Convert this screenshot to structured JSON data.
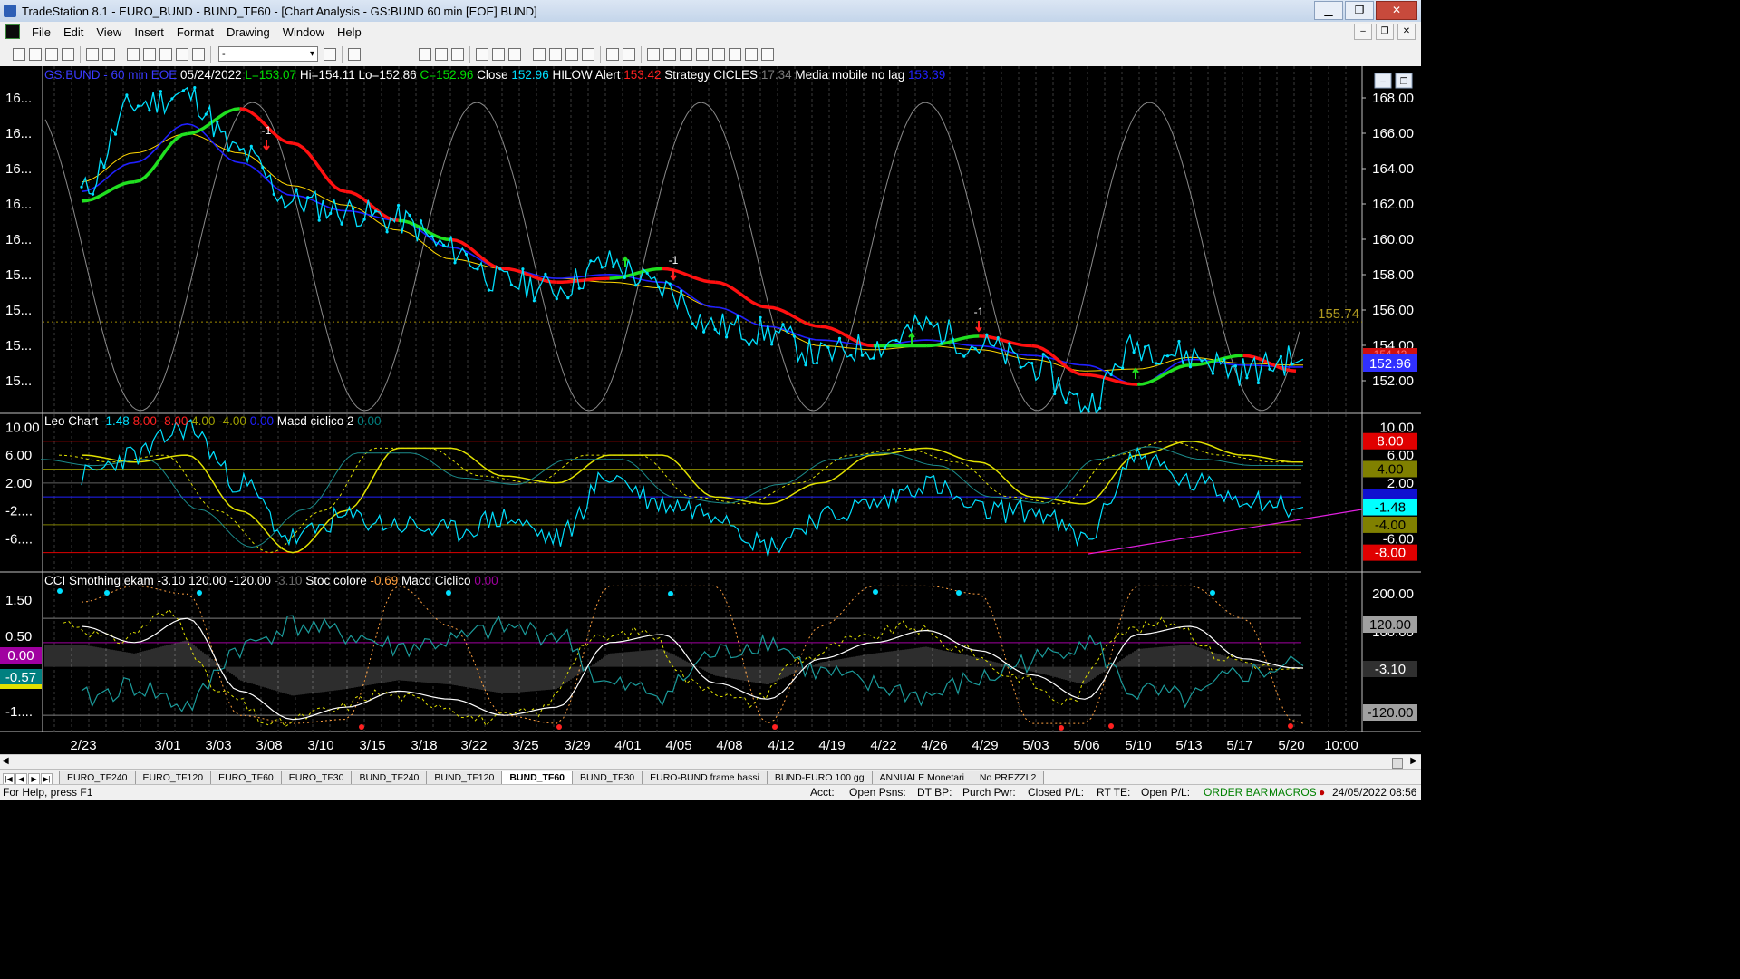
{
  "window": {
    "title": "TradeStation 8.1 - EURO_BUND - BUND_TF60 - [Chart Analysis - GS:BUND  60 min  [EOE] BUND]",
    "buttons": {
      "minimize": "▁",
      "maximize": "❐",
      "close": "✕"
    }
  },
  "menu": {
    "items": [
      "File",
      "Edit",
      "View",
      "Insert",
      "Format",
      "Drawing",
      "Window",
      "Help"
    ]
  },
  "toolbar": {
    "combo_value": "-"
  },
  "price_panel": {
    "header": [
      {
        "text": "GS:BUND - 60 min",
        "color": "#3a3aff"
      },
      {
        "text": "EOE",
        "color": "#3a3aff"
      },
      {
        "text": "05/24/2022",
        "color": "#ffffff"
      },
      {
        "text": "L=153.07",
        "color": "#00e000"
      },
      {
        "text": "Hi=154.11",
        "color": "#ffffff"
      },
      {
        "text": "Lo=152.86",
        "color": "#ffffff"
      },
      {
        "text": "C=152.96",
        "color": "#00e000"
      },
      {
        "text": "Close",
        "color": "#ffffff"
      },
      {
        "text": "152.96",
        "color": "#00e0ff"
      },
      {
        "text": "HILOW Alert",
        "color": "#ffffff"
      },
      {
        "text": "153.42",
        "color": "#ff2020"
      },
      {
        "text": "Strategy",
        "color": "#ffffff"
      },
      {
        "text": "CICLES",
        "color": "#ffffff"
      },
      {
        "text": "17.34",
        "color": "#7a7a7a"
      },
      {
        "text": "Media mobile no lag",
        "color": "#ffffff"
      },
      {
        "text": "153.39",
        "color": "#2020ff"
      }
    ],
    "left_ticks": [
      "16...",
      "16...",
      "16...",
      "16...",
      "16...",
      "15...",
      "15...",
      "15...",
      "15..."
    ],
    "right_ticks": [
      "168.00",
      "166.00",
      "164.00",
      "162.00",
      "160.00",
      "158.00",
      "156.00",
      "154.00",
      "152.00"
    ],
    "level_label": "155.74",
    "last_price_tag": "152.96",
    "hidden_tag": "154.42",
    "markers": [
      "-1",
      "-1",
      "-1"
    ]
  },
  "leo_panel": {
    "header": [
      {
        "text": "Leo Chart",
        "color": "#ffffff"
      },
      {
        "text": "-1.48",
        "color": "#00e0ff"
      },
      {
        "text": "8.00",
        "color": "#ff2020"
      },
      {
        "text": "-8.00",
        "color": "#ff2020"
      },
      {
        "text": "4.00",
        "color": "#a0a000"
      },
      {
        "text": "-4.00",
        "color": "#a0a000"
      },
      {
        "text": "0.00",
        "color": "#2020ff"
      },
      {
        "text": "Macd ciclico 2",
        "color": "#ffffff"
      },
      {
        "text": "0.00",
        "color": "#008080"
      }
    ],
    "left_ticks": [
      "10.00",
      "6.00",
      "2.00",
      "-2....",
      "-6...."
    ],
    "right_ticks": [
      "10.00",
      "6.00",
      "2.00",
      "-6.00"
    ],
    "tags": [
      {
        "text": "8.00",
        "bg": "#e00000",
        "fg": "#ffffff"
      },
      {
        "text": "4.00",
        "bg": "#808000",
        "fg": "#000000"
      },
      {
        "text": "0.00",
        "bg": "#1010d0",
        "fg": "#1010d0"
      },
      {
        "text": "-1.48",
        "bg": "#00ffff",
        "fg": "#000000"
      },
      {
        "text": "-4.00",
        "bg": "#808000",
        "fg": "#000000"
      },
      {
        "text": "-8.00",
        "bg": "#e00000",
        "fg": "#ffffff"
      }
    ]
  },
  "cci_panel": {
    "header": [
      {
        "text": "CCI Smothing ekam",
        "color": "#ffffff"
      },
      {
        "text": "-3.10",
        "color": "#ffffff"
      },
      {
        "text": "120.00",
        "color": "#ffffff"
      },
      {
        "text": "-120.00",
        "color": "#ffffff"
      },
      {
        "text": "-3.10",
        "color": "#6a6a6a"
      },
      {
        "text": "Stoc colore",
        "color": "#ffffff"
      },
      {
        "text": "-0.69",
        "color": "#ffa040"
      },
      {
        "text": "Macd Ciclico",
        "color": "#ffffff"
      },
      {
        "text": "0.00",
        "color": "#a000a0"
      }
    ],
    "left_ticks": [
      "1.50",
      "0.50",
      "-1...."
    ],
    "left_tags": [
      {
        "text": "0.00",
        "bg": "#a000a0",
        "fg": "#ffffff"
      },
      {
        "text": "-0.57",
        "bg": "#008080",
        "fg": "#ffffff"
      }
    ],
    "right_ticks": [
      "200.00",
      "100.00"
    ],
    "tags": [
      {
        "text": "120.00",
        "bg": "#a0a0a0",
        "fg": "#000000"
      },
      {
        "text": "-3.10",
        "bg": "#303030",
        "fg": "#ffffff"
      },
      {
        "text": "-120.00",
        "bg": "#a0a0a0",
        "fg": "#000000"
      }
    ]
  },
  "x_axis": [
    "2/23",
    "3/01",
    "3/03",
    "3/08",
    "3/10",
    "3/15",
    "3/18",
    "3/22",
    "3/25",
    "3/29",
    "4/01",
    "4/05",
    "4/08",
    "4/12",
    "4/19",
    "4/22",
    "4/26",
    "4/29",
    "5/03",
    "5/06",
    "5/10",
    "5/13",
    "5/17",
    "5/20",
    "10:00"
  ],
  "tabs": [
    "EURO_TF240",
    "EURO_TF120",
    "EURO_TF60",
    "EURO_TF30",
    "BUND_TF240",
    "BUND_TF120",
    "BUND_TF60",
    "BUND_TF30",
    "EURO-BUND frame bassi",
    "BUND-EURO 100 gg",
    "ANNUALE Monetari",
    "No PREZZI 2"
  ],
  "active_tab": "BUND_TF60",
  "status": {
    "help": "For Help, press F1",
    "acct": "Acct:",
    "open_psns": "Open Psns:",
    "dt_bp": "DT BP:",
    "purch_pwr": "Purch Pwr:",
    "closed_pl": "Closed P/L:",
    "rt_te": "RT TE:",
    "open_pl": "Open P/L:",
    "order_bar": "ORDER BAR",
    "macros": "MACROS",
    "datetime": "24/05/2022 08:56"
  },
  "chart_data": [
    {
      "type": "line",
      "title": "GS:BUND - 60 min",
      "x": [
        "2/23",
        "3/01",
        "3/03",
        "3/08",
        "3/10",
        "3/15",
        "3/18",
        "3/22",
        "3/25",
        "3/29",
        "4/01",
        "4/05",
        "4/08",
        "4/12",
        "4/19",
        "4/22",
        "4/26",
        "4/29",
        "5/03",
        "5/06",
        "5/10",
        "5/13",
        "5/17",
        "5/20"
      ],
      "ylim": [
        151,
        169
      ],
      "series": [
        {
          "name": "Close",
          "color": "#00e0ff",
          "values": [
            162.5,
            167.0,
            167.5,
            164.5,
            162.0,
            161.5,
            161.0,
            159.5,
            157.8,
            157.5,
            158.8,
            157.5,
            155.5,
            155.2,
            154.0,
            154.5,
            155.5,
            154.5,
            153.5,
            151.5,
            154.5,
            154.0,
            153.2,
            153.8
          ]
        },
        {
          "name": "Media mobile no lag",
          "color": "#2020ff",
          "values": [
            162.5,
            164.0,
            166.0,
            164.0,
            162.3,
            161.5,
            161.0,
            159.6,
            158.5,
            158.0,
            158.2,
            157.8,
            156.5,
            155.5,
            154.8,
            154.5,
            154.8,
            154.5,
            154.0,
            153.5,
            152.5,
            153.8,
            153.5,
            153.4
          ]
        },
        {
          "name": "Strategy",
          "color": "#ffd700",
          "values": [
            163.0,
            164.5,
            165.5,
            164.5,
            162.8,
            161.8,
            160.5,
            159.0,
            158.5,
            158.0,
            157.8,
            157.5,
            156.5,
            155.5,
            154.5,
            154.3,
            154.5,
            154.3,
            153.8,
            153.2,
            153.3,
            153.9,
            153.6,
            153.5
          ]
        },
        {
          "name": "HILOW Alert",
          "color": "#ff2020",
          "values": [
            162.0,
            163.0,
            165.5,
            166.8,
            165.0,
            162.5,
            161.0,
            160.0,
            158.5,
            157.8,
            158.0,
            158.5,
            157.8,
            156.5,
            155.5,
            154.5,
            154.5,
            155.0,
            154.5,
            153.0,
            152.5,
            153.5,
            154.0,
            153.2
          ]
        }
      ]
    },
    {
      "type": "line",
      "title": "Leo Chart",
      "x": [
        "2/23",
        "3/01",
        "3/03",
        "3/08",
        "3/10",
        "3/15",
        "3/18",
        "3/22",
        "3/25",
        "3/29",
        "4/01",
        "4/05",
        "4/08",
        "4/12",
        "4/19",
        "4/22",
        "4/26",
        "4/29",
        "5/03",
        "5/06",
        "5/10",
        "5/13",
        "5/17",
        "5/20"
      ],
      "ylim": [
        -10,
        12
      ],
      "series": [
        {
          "name": "Leo Chart",
          "color": "#00e0ff",
          "values": [
            3.0,
            6.0,
            10.0,
            2.0,
            -6.0,
            -3.0,
            -4.0,
            -5.0,
            -3.0,
            -6.0,
            3.0,
            -1.0,
            -2.0,
            -7.0,
            -3.0,
            -1.0,
            2.0,
            -2.0,
            -2.0,
            -6.0,
            6.0,
            2.0,
            0.0,
            -1.48
          ]
        },
        {
          "name": "Macd ciclico 2",
          "color": "#e0e000",
          "values": [
            6.0,
            5.0,
            6.0,
            -2.0,
            -8.0,
            -2.0,
            7.0,
            7.0,
            3.0,
            2.0,
            6.0,
            6.0,
            0.0,
            -1.0,
            2.0,
            6.0,
            7.0,
            5.0,
            0.0,
            -1.0,
            6.0,
            8.0,
            6.0,
            5.0
          ]
        }
      ]
    },
    {
      "type": "line",
      "title": "CCI Smothing ekam",
      "x": [
        "2/23",
        "3/01",
        "3/03",
        "3/08",
        "3/10",
        "3/15",
        "3/18",
        "3/22",
        "3/25",
        "3/29",
        "4/01",
        "4/05",
        "4/08",
        "4/12",
        "4/19",
        "4/22",
        "4/26",
        "4/29",
        "5/03",
        "5/06",
        "5/10",
        "5/13",
        "5/17",
        "5/20"
      ],
      "ylim": [
        -160,
        230
      ],
      "series": [
        {
          "name": "CCI Smothing ekam",
          "color": "#ffffff",
          "values": [
            100,
            60,
            120,
            -60,
            -130,
            -100,
            -60,
            -80,
            -120,
            -100,
            60,
            80,
            -40,
            -80,
            20,
            60,
            90,
            40,
            -20,
            -80,
            80,
            100,
            20,
            -3.1
          ]
        },
        {
          "name": "Stoc colore",
          "color": "#ffa040",
          "values": [
            160,
            200,
            180,
            -120,
            -140,
            -130,
            200,
            100,
            -120,
            -140,
            200,
            200,
            200,
            -140,
            100,
            200,
            200,
            180,
            -140,
            -140,
            200,
            200,
            120,
            -140
          ]
        }
      ]
    }
  ]
}
